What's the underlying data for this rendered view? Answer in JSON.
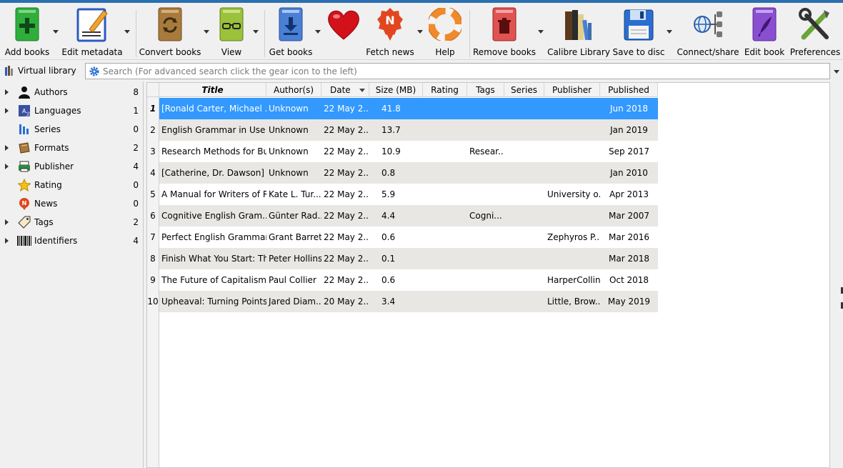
{
  "toolbar": {
    "add_books": "Add books",
    "edit_metadata": "Edit metadata",
    "convert_books": "Convert books",
    "view": "View",
    "get_books": "Get books",
    "fetch_news": "Fetch news",
    "help": "Help",
    "remove_books": "Remove books",
    "calibre_library": "Calibre Library",
    "save_to_disc": "Save to disc",
    "connect_share": "Connect/share",
    "edit_book": "Edit book",
    "preferences": "Preferences"
  },
  "search": {
    "virtual_library": "Virtual library",
    "placeholder": "Search (For advanced search click the gear icon to the left)"
  },
  "tag_browser": {
    "items": [
      {
        "name": "Authors",
        "count": "8",
        "icon": "person-icon"
      },
      {
        "name": "Languages",
        "count": "1",
        "icon": "languages-icon"
      },
      {
        "name": "Series",
        "count": "0",
        "icon": "series-icon"
      },
      {
        "name": "Formats",
        "count": "2",
        "icon": "book-icon"
      },
      {
        "name": "Publisher",
        "count": "4",
        "icon": "publisher-icon"
      },
      {
        "name": "Rating",
        "count": "0",
        "icon": "star-icon"
      },
      {
        "name": "News",
        "count": "0",
        "icon": "news-icon"
      },
      {
        "name": "Tags",
        "count": "2",
        "icon": "tag-icon"
      },
      {
        "name": "Identifiers",
        "count": "4",
        "icon": "barcode-icon"
      }
    ]
  },
  "booklist": {
    "columns": [
      "Title",
      "Author(s)",
      "Date",
      "Size (MB)",
      "Rating",
      "Tags",
      "Series",
      "Publisher",
      "Published"
    ],
    "rows": [
      {
        "num": "1",
        "title": "[Ronald Carter, Michael ...",
        "author": "Unknown",
        "date": "22 May 2...",
        "size": "41.8",
        "rating": "",
        "tags": "",
        "series": "",
        "publisher": "",
        "published": "Jun 2018"
      },
      {
        "num": "2",
        "title": "English Grammar in Use -...",
        "author": "Unknown",
        "date": "22 May 2...",
        "size": "13.7",
        "rating": "",
        "tags": "",
        "series": "",
        "publisher": "",
        "published": "Jan 2019"
      },
      {
        "num": "3",
        "title": "Research Methods for Bu...",
        "author": "Unknown",
        "date": "22 May 2...",
        "size": "10.9",
        "rating": "",
        "tags": "Resear...",
        "series": "",
        "publisher": "",
        "published": "Sep 2017"
      },
      {
        "num": "4",
        "title": "[Catherine, Dr. Dawson] I...",
        "author": "Unknown",
        "date": "22 May 2...",
        "size": "0.8",
        "rating": "",
        "tags": "",
        "series": "",
        "publisher": "",
        "published": "Jan 2010"
      },
      {
        "num": "5",
        "title": "A Manual for Writers of R...",
        "author": "Kate L. Tur...",
        "date": "22 May 2...",
        "size": "5.9",
        "rating": "",
        "tags": "",
        "series": "",
        "publisher": "University o...",
        "published": "Apr 2013"
      },
      {
        "num": "6",
        "title": "Cognitive English Gram...",
        "author": "Günter Rad...",
        "date": "22 May 2...",
        "size": "4.4",
        "rating": "",
        "tags": "Cogni...",
        "series": "",
        "publisher": "",
        "published": "Mar 2007"
      },
      {
        "num": "7",
        "title": "Perfect English Grammar:...",
        "author": "Grant Barrett",
        "date": "22 May 2...",
        "size": "0.6",
        "rating": "",
        "tags": "",
        "series": "",
        "publisher": "Zephyros P...",
        "published": "Mar 2016"
      },
      {
        "num": "8",
        "title": "Finish What You Start: Th...",
        "author": "Peter Hollins",
        "date": "22 May 2...",
        "size": "0.1",
        "rating": "",
        "tags": "",
        "series": "",
        "publisher": "",
        "published": "Mar 2018"
      },
      {
        "num": "9",
        "title": "The Future of Capitalism",
        "author": "Paul Collier",
        "date": "22 May 2...",
        "size": "0.6",
        "rating": "",
        "tags": "",
        "series": "",
        "publisher": "HarperCollins",
        "published": "Oct 2018"
      },
      {
        "num": "10",
        "title": "Upheaval: Turning Points...",
        "author": "Jared Diam...",
        "date": "20 May 2...",
        "size": "3.4",
        "rating": "",
        "tags": "",
        "series": "",
        "publisher": "Little, Brow...",
        "published": "May 2019"
      }
    ]
  },
  "colors": {
    "selection": "#3399ff",
    "alt_row": "#e8e7e4",
    "accent_blue": "#2a6fb0"
  }
}
